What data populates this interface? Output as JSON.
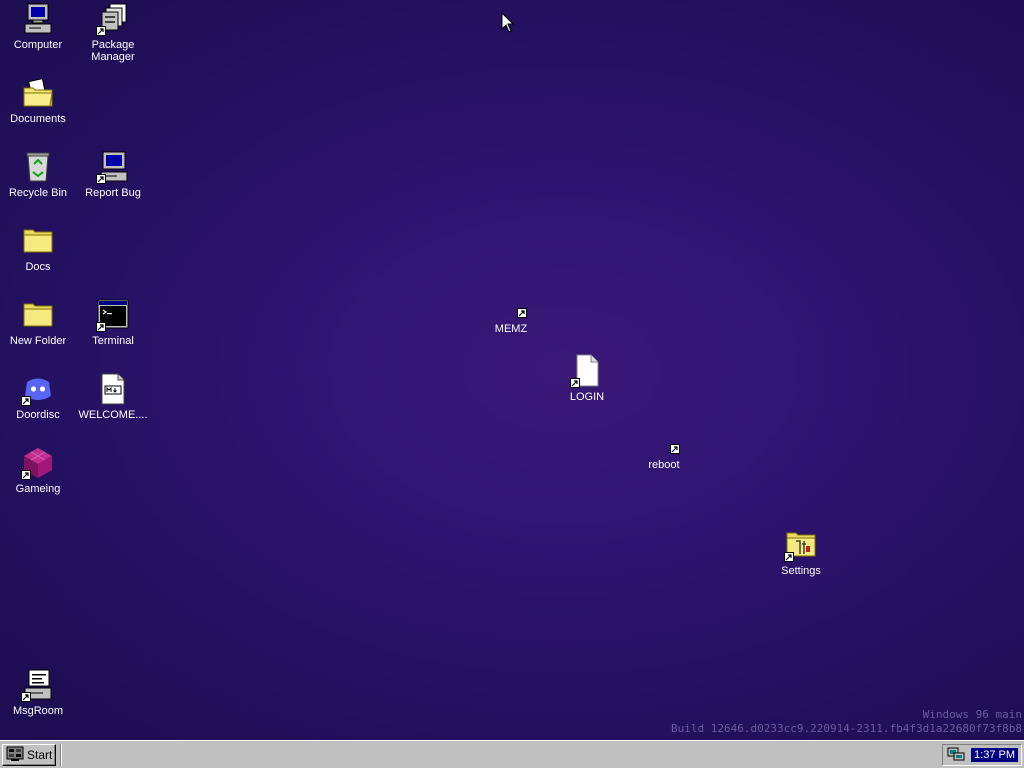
{
  "desktop": {
    "icons": {
      "computer": "Computer",
      "package_manager": "Package Manager",
      "documents": "Documents",
      "recycle_bin": "Recycle Bin",
      "report_bug": "Report Bug",
      "docs": "Docs",
      "new_folder": "New Folder",
      "terminal": "Terminal",
      "doordisc": "Doordisc",
      "welcome": "WELCOME....",
      "gameing": "Gameing",
      "memz": "MEMZ",
      "login": "LOGIN",
      "reboot": "reboot",
      "settings": "Settings",
      "msgroom": "MsgRoom"
    },
    "watermark": {
      "line1": "Windows 96 main",
      "line2": "Build 12646.d0233cc9.220914-2311.fb4f3d1a22680f73f8b8"
    }
  },
  "taskbar": {
    "start_label": "Start",
    "clock": "1:37 PM"
  },
  "colors": {
    "desktop_bg": "#2a1368",
    "taskbar_bg": "#c0c0c0",
    "clock_highlight": "#000080"
  }
}
